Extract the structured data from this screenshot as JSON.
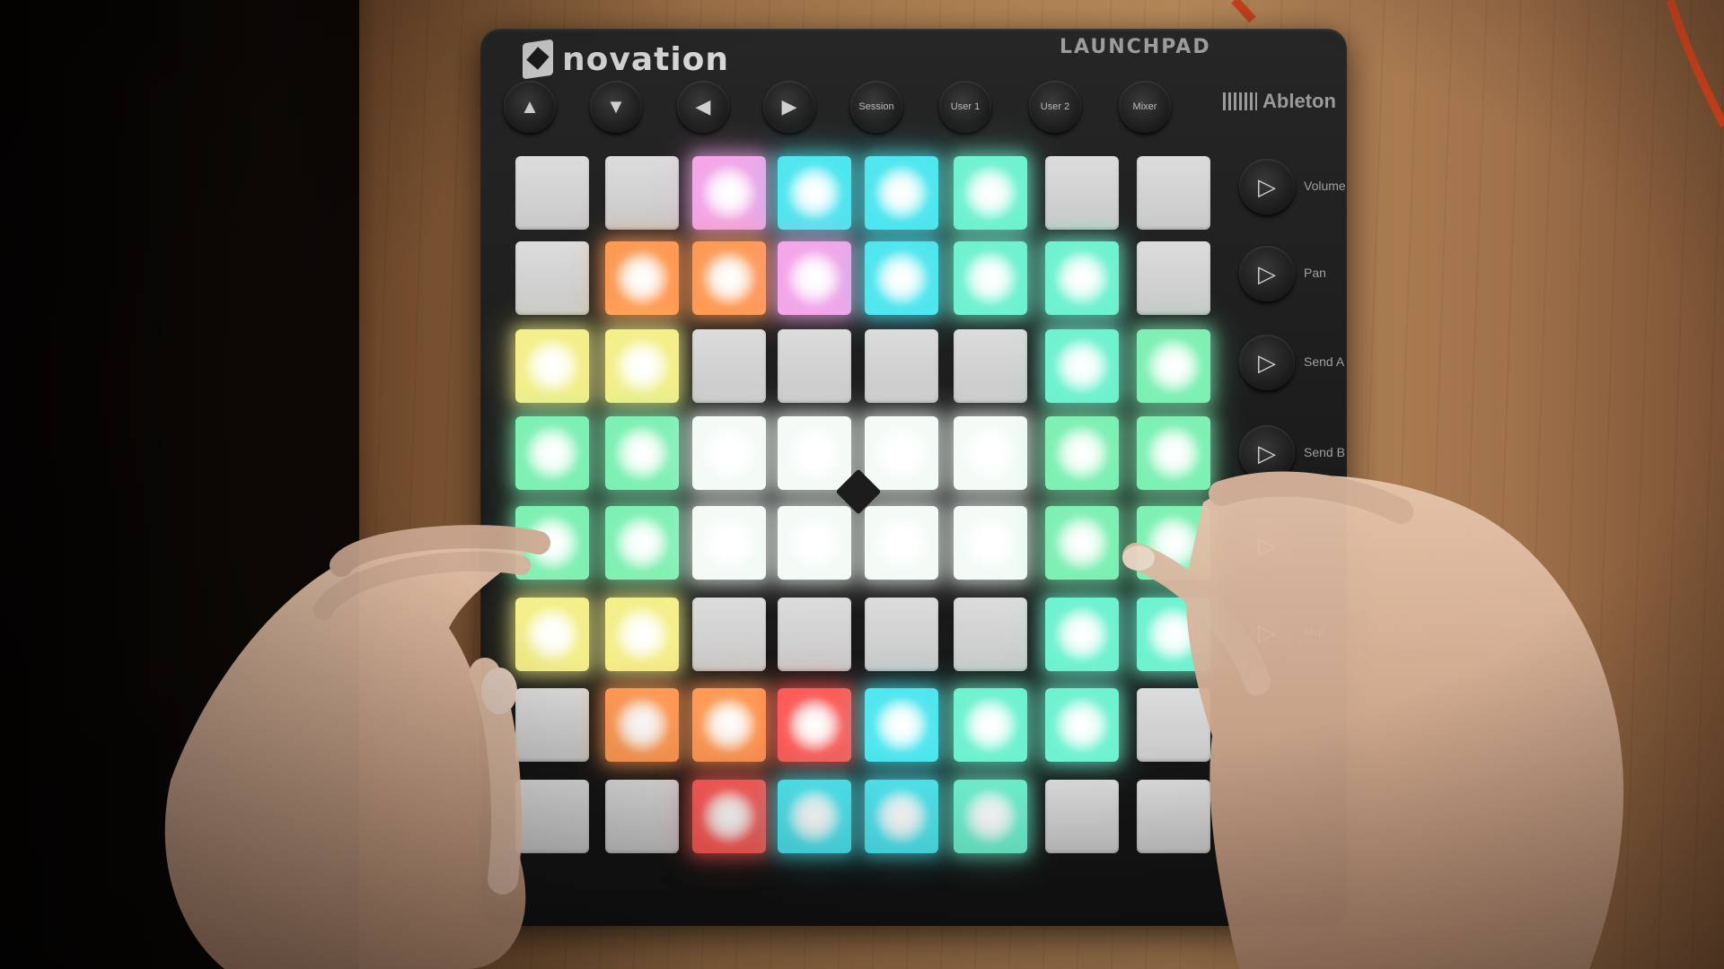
{
  "device": {
    "brand": "novation",
    "model": "LAUNCHPAD",
    "partner": "Ableton"
  },
  "top_buttons": [
    {
      "name": "up-arrow-button",
      "icon": "▲"
    },
    {
      "name": "down-arrow-button",
      "icon": "▼"
    },
    {
      "name": "left-arrow-button",
      "icon": "◀"
    },
    {
      "name": "right-arrow-button",
      "icon": "▶"
    },
    {
      "name": "session-button",
      "label": "Session"
    },
    {
      "name": "user1-button",
      "label": "User 1"
    },
    {
      "name": "user2-button",
      "label": "User 2"
    },
    {
      "name": "mixer-button",
      "label": "Mixer"
    }
  ],
  "side_buttons": [
    {
      "label": "Volume"
    },
    {
      "label": "Pan"
    },
    {
      "label": "Send A"
    },
    {
      "label": "Send B"
    },
    {
      "label": ""
    },
    {
      "label": "Mut"
    }
  ],
  "palette": {
    "off": "#d2d2d2",
    "W": "#f4fbf7",
    "C": "#4fe6f0",
    "M": "#6ff2d0",
    "G": "#7ef0b4",
    "Y": "#f4ef8a",
    "O": "#ff9a55",
    "R": "#ff5b57",
    "P": "#f3a6ea"
  },
  "pad_grid": [
    [
      "off",
      "off",
      "P",
      "C",
      "C",
      "M",
      "off",
      "off"
    ],
    [
      "off",
      "O",
      "O",
      "P",
      "C",
      "M",
      "M",
      "off"
    ],
    [
      "Y",
      "Y",
      "off",
      "off",
      "off",
      "off",
      "M",
      "G"
    ],
    [
      "G",
      "G",
      "W",
      "W",
      "W",
      "W",
      "G",
      "G"
    ],
    [
      "G",
      "G",
      "W",
      "W",
      "W",
      "W",
      "G",
      "G"
    ],
    [
      "Y",
      "Y",
      "off",
      "off",
      "off",
      "off",
      "M",
      "M"
    ],
    [
      "off",
      "O",
      "O",
      "R",
      "C",
      "M",
      "M",
      "off"
    ],
    [
      "off",
      "off",
      "R",
      "C",
      "C",
      "M",
      "off",
      "off"
    ]
  ]
}
